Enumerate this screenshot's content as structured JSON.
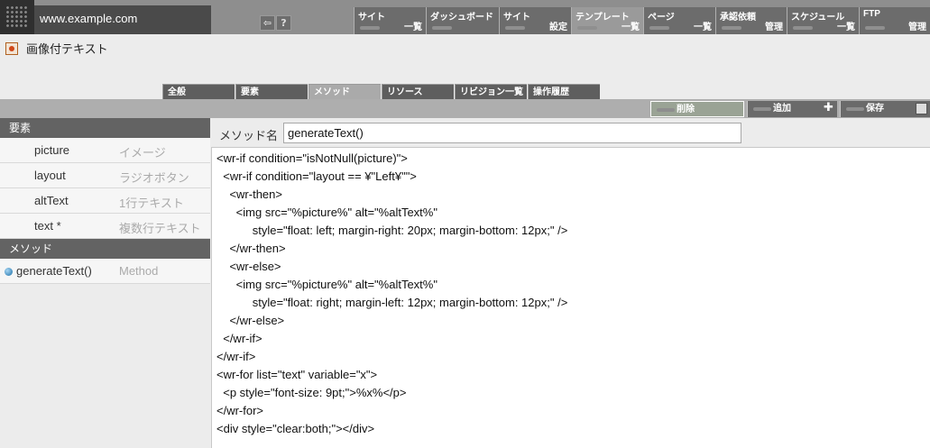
{
  "header": {
    "site_url": "www.example.com",
    "icons": [
      "back-icon",
      "help-icon"
    ],
    "help_label": "?",
    "nav": [
      {
        "line1": "サイト",
        "line2": "一覧"
      },
      {
        "line1": "ダッシュボード",
        "line2": ""
      },
      {
        "line1": "サイト",
        "line2": "設定"
      },
      {
        "line1": "テンプレート",
        "line2": "一覧"
      },
      {
        "line1": "ページ",
        "line2": "一覧"
      },
      {
        "line1": "承認依頼",
        "line2": "管理"
      },
      {
        "line1": "スケジュール",
        "line2": "一覧"
      },
      {
        "line1": "FTP",
        "line2": "管理"
      }
    ],
    "active_nav_index": 3
  },
  "page": {
    "title": "画像付テキスト"
  },
  "tabs": [
    "全般",
    "要素",
    "メソッド",
    "リソース",
    "リビジョン一覧",
    "操作履歴"
  ],
  "active_tab_index": 2,
  "actions": {
    "delete_label": "削除",
    "add_label": "追加",
    "save_label": "保存"
  },
  "sidebar": {
    "elements_header": "要素",
    "elements": [
      {
        "name": "picture",
        "kind": "イメージ"
      },
      {
        "name": "layout",
        "kind": "ラジオボタン"
      },
      {
        "name": "altText",
        "kind": "1行テキスト"
      },
      {
        "name": "text *",
        "kind": "複数行テキスト"
      }
    ],
    "methods_header": "メソッド",
    "methods": [
      {
        "name": "generateText()",
        "kind": "Method"
      }
    ]
  },
  "editor": {
    "method_name_label": "メソッド名",
    "method_name_value": "generateText()",
    "code_lines": [
      "<wr-if condition=\"isNotNull(picture)\">",
      "  <wr-if condition=\"layout == ¥\"Left¥\"\">",
      "    <wr-then>",
      "      <img src=\"%picture%\" alt=\"%altText%\"",
      "           style=\"float: left; margin-right: 20px; margin-bottom: 12px;\" />",
      "    </wr-then>",
      "    <wr-else>",
      "      <img src=\"%picture%\" alt=\"%altText%\"",
      "           style=\"float: right; margin-left: 12px; margin-bottom: 12px;\" />",
      "    </wr-else>",
      "  </wr-if>",
      "</wr-if>",
      "<wr-for list=\"text\" variable=\"x\">",
      "  <p style=\"font-size: 9pt;\">%x%</p>",
      "</wr-for>",
      "<div style=\"clear:both;\"></div>"
    ]
  }
}
